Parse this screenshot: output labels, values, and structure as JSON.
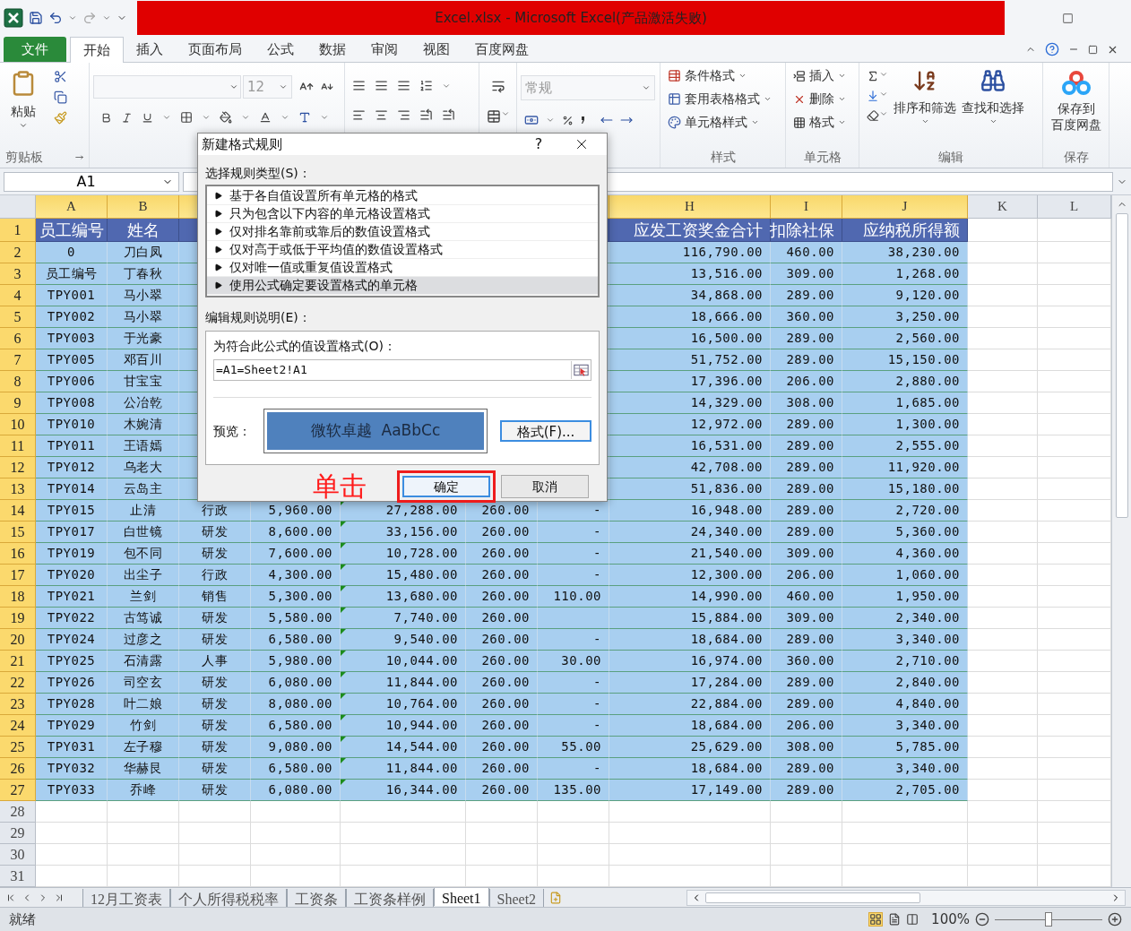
{
  "title_bar": {
    "title": "Excel.xlsx - Microsoft Excel(产品激活失败)"
  },
  "ribbon_tabs": [
    {
      "label": "文件",
      "kind": "file"
    },
    {
      "label": "开始",
      "kind": "tab",
      "selected": true
    },
    {
      "label": "插入",
      "kind": "tab",
      "selected": false
    },
    {
      "label": "页面布局",
      "kind": "tab",
      "selected": false
    },
    {
      "label": "公式",
      "kind": "tab",
      "selected": false
    },
    {
      "label": "数据",
      "kind": "tab",
      "selected": false
    },
    {
      "label": "审阅",
      "kind": "tab",
      "selected": false
    },
    {
      "label": "视图",
      "kind": "tab",
      "selected": false
    },
    {
      "label": "百度网盘",
      "kind": "tab",
      "selected": false
    }
  ],
  "ribbon": {
    "clipboard": {
      "paste": "粘贴",
      "label": "剪贴板"
    },
    "font": {
      "size": "12"
    },
    "number": {
      "format": "常规"
    },
    "styles": {
      "items": [
        "条件格式",
        "套用表格格式",
        "单元格样式"
      ],
      "label": "样式"
    },
    "cells": {
      "items": [
        "插入",
        "删除",
        "格式"
      ],
      "label": "单元格"
    },
    "editing": {
      "sort": "排序和筛选",
      "find": "查找和选择",
      "label": "编辑"
    },
    "save": {
      "lines": [
        "保存到",
        "百度网盘"
      ],
      "label": "保存"
    }
  },
  "formula_bar": {
    "name_box": "A1"
  },
  "sheet": {
    "columns": [
      {
        "label": "A",
        "selected": true
      },
      {
        "label": "B",
        "selected": true
      },
      {
        "selected": true
      },
      {
        "selected": true
      },
      {
        "selected": true
      },
      {
        "selected": true
      },
      {
        "selected": true
      },
      {
        "label": "H",
        "selected": true
      },
      {
        "label": "I",
        "selected": true
      },
      {
        "label": "J",
        "selected": true
      },
      {
        "label": "K",
        "selected": false
      },
      {
        "label": "L",
        "selected": false
      }
    ],
    "rows": [
      {
        "number": "1",
        "selected": true,
        "header": true,
        "cells": [
          "员工编号",
          "姓名",
          null,
          null,
          null,
          null,
          null,
          "应发工资奖金合计",
          "扣除社保",
          "应纳税所得额"
        ]
      },
      {
        "number": "2",
        "selected": true,
        "cells": [
          "0",
          "刀白凤",
          null,
          null,
          null,
          null,
          null,
          "116,790.00",
          "460.00",
          "38,230.00"
        ]
      },
      {
        "number": "3",
        "selected": true,
        "cells": [
          "员工编号",
          "丁春秋",
          null,
          null,
          null,
          null,
          null,
          "13,516.00",
          "309.00",
          "1,268.00"
        ]
      },
      {
        "number": "4",
        "selected": true,
        "cells": [
          "TPY001",
          "马小翠",
          null,
          null,
          null,
          null,
          null,
          "34,868.00",
          "289.00",
          "9,120.00"
        ]
      },
      {
        "number": "5",
        "selected": true,
        "cells": [
          "TPY002",
          "马小翠",
          null,
          null,
          null,
          null,
          null,
          "18,666.00",
          "360.00",
          "3,250.00"
        ]
      },
      {
        "number": "6",
        "selected": true,
        "cells": [
          "TPY003",
          "于光豪",
          null,
          null,
          null,
          null,
          null,
          "16,500.00",
          "289.00",
          "2,560.00"
        ]
      },
      {
        "number": "7",
        "selected": true,
        "cells": [
          "TPY005",
          "邓百川",
          null,
          null,
          null,
          null,
          null,
          "51,752.00",
          "289.00",
          "15,150.00"
        ]
      },
      {
        "number": "8",
        "selected": true,
        "cells": [
          "TPY006",
          "甘宝宝",
          null,
          null,
          null,
          null,
          null,
          "17,396.00",
          "206.00",
          "2,880.00"
        ]
      },
      {
        "number": "9",
        "selected": true,
        "cells": [
          "TPY008",
          "公冶乾",
          null,
          null,
          null,
          null,
          null,
          "14,329.00",
          "308.00",
          "1,685.00"
        ]
      },
      {
        "number": "10",
        "selected": true,
        "cells": [
          "TPY010",
          "木婉清",
          null,
          null,
          null,
          null,
          null,
          "12,972.00",
          "289.00",
          "1,300.00"
        ]
      },
      {
        "number": "11",
        "selected": true,
        "cells": [
          "TPY011",
          "王语嫣",
          null,
          null,
          null,
          null,
          null,
          "16,531.00",
          "289.00",
          "2,555.00"
        ]
      },
      {
        "number": "12",
        "selected": true,
        "cells": [
          "TPY012",
          "乌老大",
          null,
          null,
          null,
          null,
          null,
          "42,708.00",
          "289.00",
          "11,920.00"
        ]
      },
      {
        "number": "13",
        "selected": true,
        "cells": [
          "TPY014",
          "云岛主",
          null,
          null,
          null,
          null,
          null,
          "51,836.00",
          "289.00",
          "15,180.00"
        ]
      },
      {
        "number": "14",
        "selected": true,
        "flagged": true,
        "cells": [
          "TPY015",
          "止清",
          "行政",
          "5,960.00",
          "27,288.00",
          "260.00",
          "-",
          "16,948.00",
          "289.00",
          "2,720.00"
        ]
      },
      {
        "number": "15",
        "selected": true,
        "flagged": true,
        "cells": [
          "TPY017",
          "白世镜",
          "研发",
          "8,600.00",
          "33,156.00",
          "260.00",
          "-",
          "24,340.00",
          "289.00",
          "5,360.00"
        ]
      },
      {
        "number": "16",
        "selected": true,
        "flagged": true,
        "cells": [
          "TPY019",
          "包不同",
          "研发",
          "7,600.00",
          "10,728.00",
          "260.00",
          "-",
          "21,540.00",
          "309.00",
          "4,360.00"
        ]
      },
      {
        "number": "17",
        "selected": true,
        "flagged": true,
        "cells": [
          "TPY020",
          "出尘子",
          "行政",
          "4,300.00",
          "15,480.00",
          "260.00",
          "-",
          "12,300.00",
          "206.00",
          "1,060.00"
        ]
      },
      {
        "number": "18",
        "selected": true,
        "flagged": true,
        "cells": [
          "TPY021",
          "兰剑",
          "销售",
          "5,300.00",
          "13,680.00",
          "260.00",
          "110.00",
          "14,990.00",
          "460.00",
          "1,950.00"
        ]
      },
      {
        "number": "19",
        "selected": true,
        "flagged": true,
        "cells": [
          "TPY022",
          "古笃诚",
          "研发",
          "5,580.00",
          "7,740.00",
          "260.00",
          null,
          "15,884.00",
          "309.00",
          "2,340.00"
        ]
      },
      {
        "number": "20",
        "selected": true,
        "flagged": true,
        "cells": [
          "TPY024",
          "过彦之",
          "研发",
          "6,580.00",
          "9,540.00",
          "260.00",
          "-",
          "18,684.00",
          "289.00",
          "3,340.00"
        ]
      },
      {
        "number": "21",
        "selected": true,
        "flagged": true,
        "cells": [
          "TPY025",
          "石清露",
          "人事",
          "5,980.00",
          "10,044.00",
          "260.00",
          "30.00",
          "16,974.00",
          "360.00",
          "2,710.00"
        ]
      },
      {
        "number": "22",
        "selected": true,
        "flagged": true,
        "cells": [
          "TPY026",
          "司空玄",
          "研发",
          "6,080.00",
          "11,844.00",
          "260.00",
          "-",
          "17,284.00",
          "289.00",
          "2,840.00"
        ]
      },
      {
        "number": "23",
        "selected": true,
        "flagged": true,
        "cells": [
          "TPY028",
          "叶二娘",
          "研发",
          "8,080.00",
          "10,764.00",
          "260.00",
          "-",
          "22,884.00",
          "289.00",
          "4,840.00"
        ]
      },
      {
        "number": "24",
        "selected": true,
        "flagged": true,
        "cells": [
          "TPY029",
          "竹剑",
          "研发",
          "6,580.00",
          "10,944.00",
          "260.00",
          "-",
          "18,684.00",
          "206.00",
          "3,340.00"
        ]
      },
      {
        "number": "25",
        "selected": true,
        "flagged": true,
        "cells": [
          "TPY031",
          "左子穆",
          "研发",
          "9,080.00",
          "14,544.00",
          "260.00",
          "55.00",
          "25,629.00",
          "308.00",
          "5,785.00"
        ]
      },
      {
        "number": "26",
        "selected": true,
        "flagged": true,
        "cells": [
          "TPY032",
          "华赫艮",
          "研发",
          "6,580.00",
          "11,844.00",
          "260.00",
          "-",
          "18,684.00",
          "289.00",
          "3,340.00"
        ]
      },
      {
        "number": "27",
        "selected": true,
        "flagged": true,
        "cells": [
          "TPY033",
          "乔峰",
          "研发",
          "6,080.00",
          "16,344.00",
          "260.00",
          "135.00",
          "17,149.00",
          "289.00",
          "2,705.00"
        ]
      },
      {
        "number": "28",
        "selected": false
      },
      {
        "number": "29",
        "selected": false
      },
      {
        "number": "30",
        "selected": false
      },
      {
        "number": "31",
        "selected": false
      }
    ]
  },
  "dialog": {
    "title": "新建格式规则",
    "help": "?",
    "rule_type_label": "选择规则类型(S)：",
    "rule_types": [
      {
        "label": "基于各自值设置所有单元格的格式",
        "selected": false
      },
      {
        "label": "只为包含以下内容的单元格设置格式",
        "selected": false
      },
      {
        "label": "仅对排名靠前或靠后的数值设置格式",
        "selected": false
      },
      {
        "label": "仅对高于或低于平均值的数值设置格式",
        "selected": false
      },
      {
        "label": "仅对唯一值或重复值设置格式",
        "selected": false
      },
      {
        "label": "使用公式确定要设置格式的单元格",
        "selected": true
      }
    ],
    "edit_label": "编辑规则说明(E)：",
    "formula_label": "为符合此公式的值设置格式(O)：",
    "formula": "=A1=Sheet2!A1",
    "preview_label": "预览：",
    "preview_text": "微软卓越  AaBbCc",
    "format_button": "格式(F)...",
    "annotation": "单击",
    "ok": {
      "label": "确定",
      "highlighted": true
    },
    "cancel": "取消"
  },
  "sheet_tabs": [
    {
      "label": "12月工资表",
      "selected": false
    },
    {
      "label": "个人所得税税率",
      "selected": false
    },
    {
      "label": "工资条",
      "selected": false
    },
    {
      "label": "工资条样例",
      "selected": false
    },
    {
      "label": "Sheet1",
      "selected": true
    },
    {
      "label": "Sheet2",
      "selected": false
    }
  ],
  "status_bar": {
    "status": "就绪",
    "zoom": "100%",
    "zoom_slider": {
      "level": 0.5
    }
  }
}
